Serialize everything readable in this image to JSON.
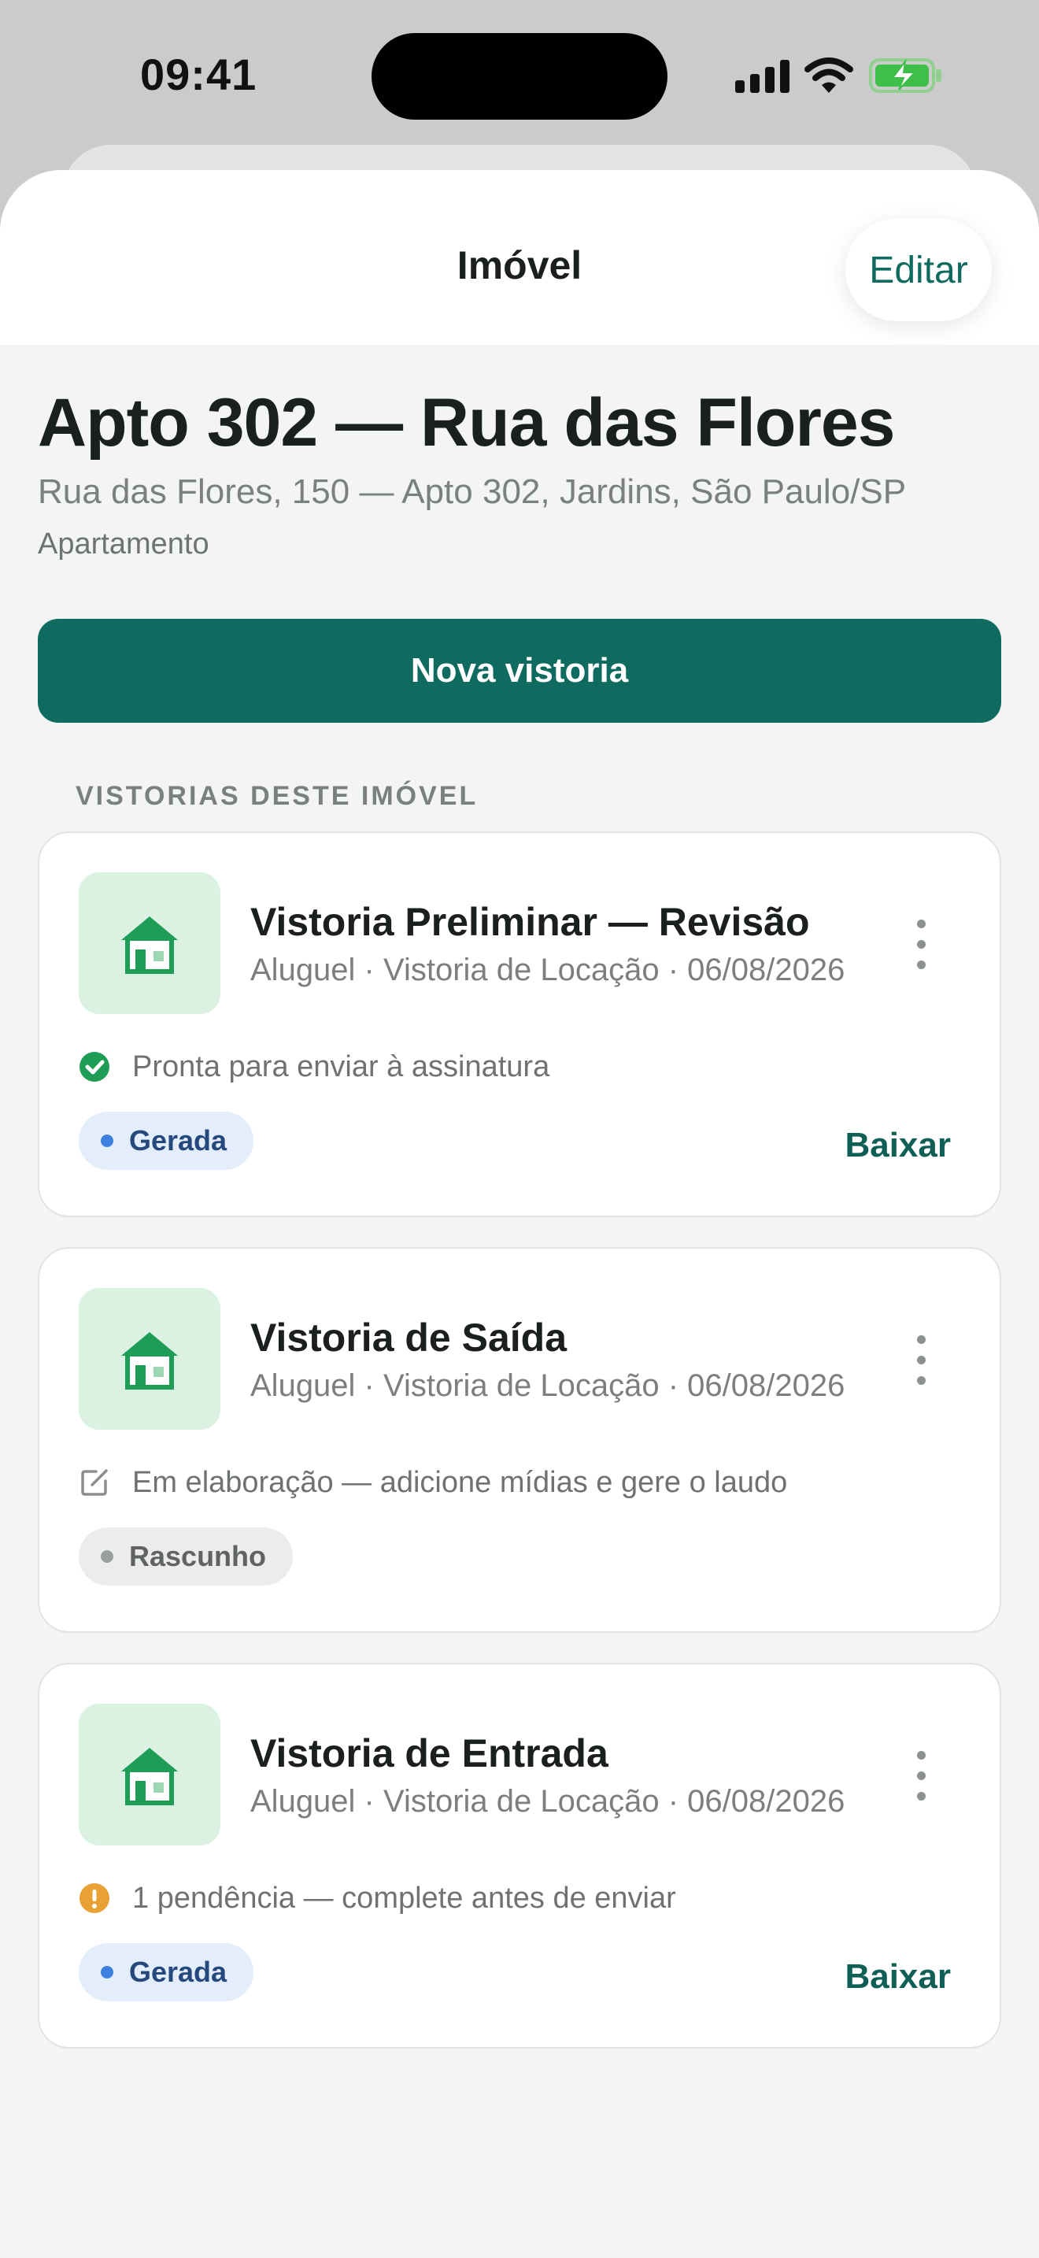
{
  "status_bar": {
    "time": "09:41"
  },
  "header": {
    "title": "Imóvel",
    "edit_label": "Editar"
  },
  "property": {
    "title": "Apto 302 — Rua das Flores",
    "address": "Rua das Flores, 150 — Apto 302, Jardins, São Paulo/SP",
    "type": "Apartamento"
  },
  "actions": {
    "new_inspection": "Nova vistoria"
  },
  "section": {
    "title": "VISTORIAS DESTE IMÓVEL"
  },
  "inspections": [
    {
      "title": "Vistoria Preliminar — Revisão",
      "meta": "Aluguel · Vistoria de Locação · 06/08/2026",
      "status_icon": "check-circle-icon",
      "status_text": "Pronta para enviar à assinatura",
      "badge": "Gerada",
      "download_label": "Baixar"
    },
    {
      "title": "Vistoria de Saída",
      "meta": "Aluguel · Vistoria de Locação · 06/08/2026",
      "status_icon": "edit-icon",
      "status_text": "Em elaboração — adicione mídias e gere o laudo",
      "badge": "Rascunho",
      "download_label": ""
    },
    {
      "title": "Vistoria de Entrada",
      "meta": "Aluguel · Vistoria de Locação · 06/08/2026",
      "status_icon": "warning-circle-icon",
      "status_text": "1 pendência — complete antes de enviar",
      "badge": "Gerada",
      "download_label": "Baixar"
    }
  ],
  "colors": {
    "primary": "#0f6b60",
    "success": "#1f9d57",
    "warning": "#e9a035",
    "badge_blue": "#e3edfb",
    "badge_gray": "#ececec"
  }
}
